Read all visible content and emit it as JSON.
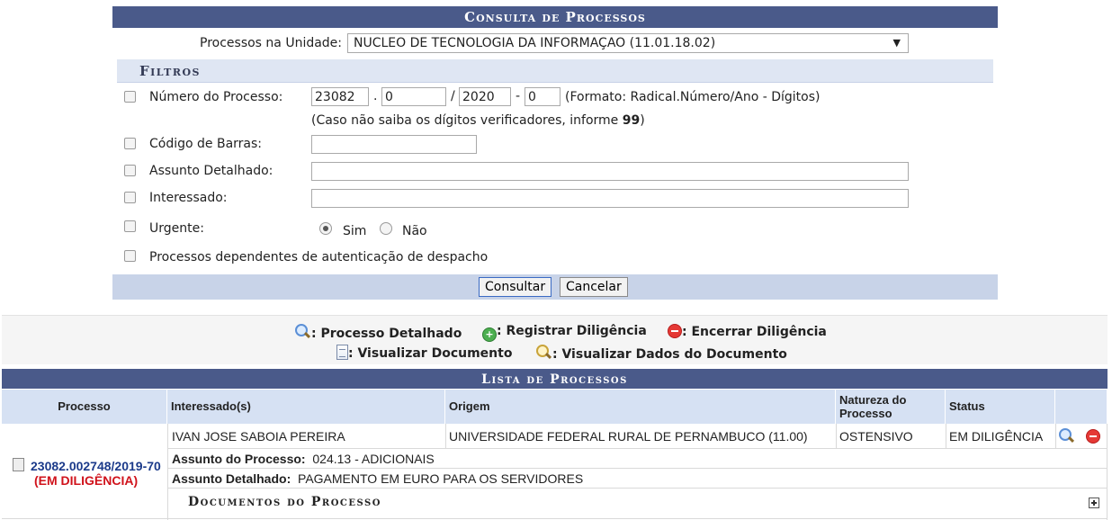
{
  "form": {
    "title": "Consulta de Processos",
    "unit_label": "Processos na Unidade:",
    "unit_value": "NUCLEO DE TECNOLOGIA DA INFORMAÇAO (11.01.18.02)",
    "filters_title": "Filtros",
    "numero": {
      "label": "Número do Processo:",
      "radical": "23082",
      "numero": "0",
      "ano": "2020",
      "digitos": "0",
      "format_hint": "(Formato: Radical.Número/Ano - Dígitos)",
      "hint_prefix": "(Caso não saiba os dígitos verificadores, informe ",
      "hint_bold": "99",
      "hint_suffix": ")"
    },
    "codigo_barras_label": "Código de Barras:",
    "assunto_label": "Assunto Detalhado:",
    "interessado_label": "Interessado:",
    "urgente_label": "Urgente:",
    "sim_label": "Sim",
    "nao_label": "Não",
    "dependentes_label": "Processos dependentes de autenticação de despacho",
    "consultar_label": "Consultar",
    "cancelar_label": "Cancelar"
  },
  "legend": {
    "detalhado": ": Processo Detalhado",
    "registrar": ": Registrar Diligência",
    "encerrar": ": Encerrar Diligência",
    "visualizar_doc": ": Visualizar Documento",
    "visualizar_dados": ": Visualizar Dados do Documento"
  },
  "list": {
    "title": "Lista de Processos",
    "headers": {
      "processo": "Processo",
      "interessados": "Interessado(s)",
      "origem": "Origem",
      "natureza_line1": "Natureza do",
      "natureza_line2": "Processo",
      "status": "Status"
    },
    "row": {
      "numero": "23082.002748/2019-70",
      "situacao": "(EM DILIGÊNCIA)",
      "interessado": "IVAN JOSE SABOIA PEREIRA",
      "origem": "UNIVERSIDADE FEDERAL RURAL DE PERNAMBUCO (11.00)",
      "natureza": "OSTENSIVO",
      "status": "EM DILIGÊNCIA",
      "assunto_label": "Assunto do Processo:",
      "assunto_value": "024.13 - ADICIONAIS",
      "assunto_det_label": "Assunto Detalhado:",
      "assunto_det_value": "PAGAMENTO EM EURO PARA OS SERVIDORES"
    },
    "docs_title": "Documentos do Processo"
  }
}
